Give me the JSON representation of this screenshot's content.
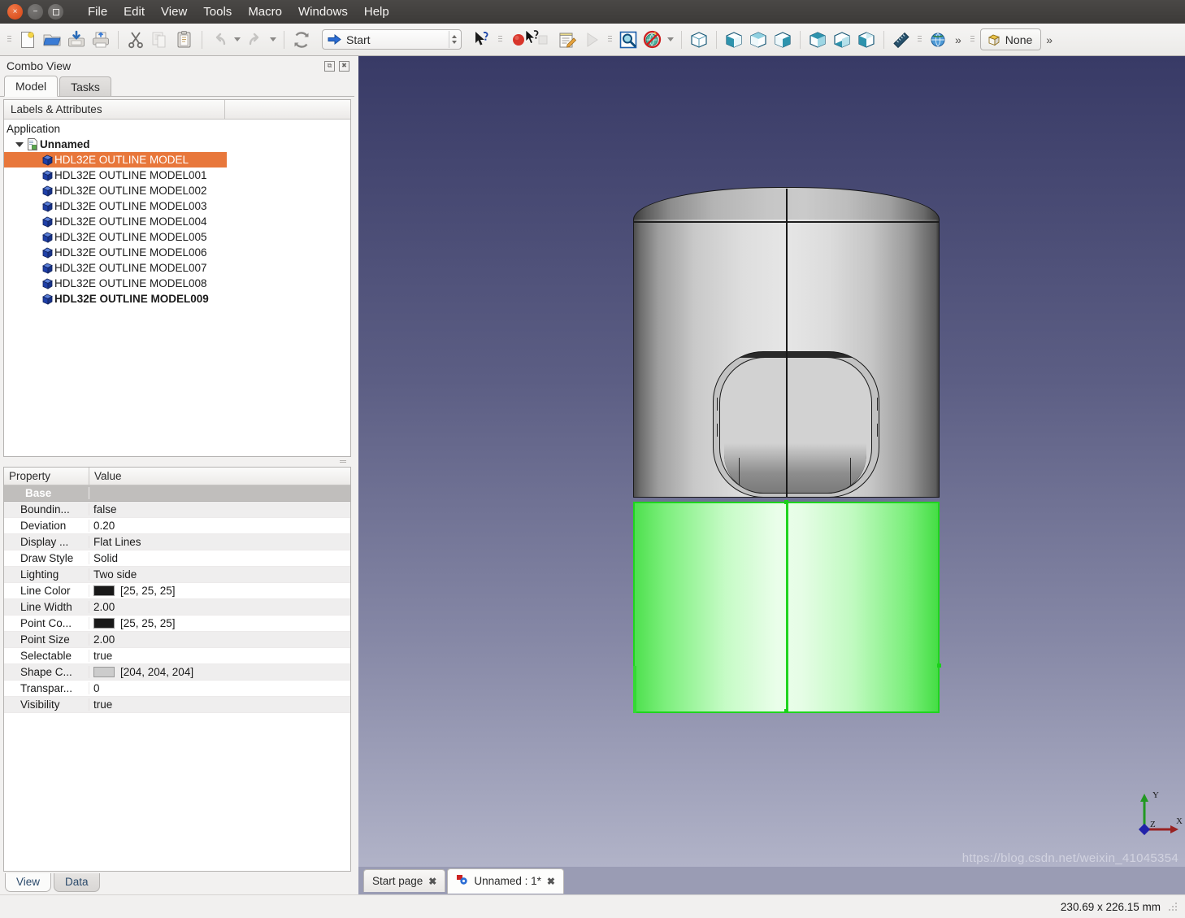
{
  "window": {
    "buttons": [
      {
        "name": "close",
        "glyph": "×"
      },
      {
        "name": "minimize",
        "glyph": "−"
      },
      {
        "name": "maximize",
        "glyph": ""
      }
    ]
  },
  "menubar": {
    "items": [
      "File",
      "Edit",
      "View",
      "Tools",
      "Macro",
      "Windows",
      "Help"
    ]
  },
  "toolbar": {
    "file_group": [
      {
        "name": "new-document-icon",
        "tip": "New"
      },
      {
        "name": "open-folder-icon",
        "tip": "Open"
      },
      {
        "name": "save-document-icon",
        "tip": "Save"
      },
      {
        "name": "print-icon",
        "tip": "Print"
      }
    ],
    "clipboard_group": [
      {
        "name": "cut-scissors-icon",
        "tip": "Cut"
      },
      {
        "name": "copy-icon",
        "tip": "Copy"
      },
      {
        "name": "paste-icon",
        "tip": "Paste"
      }
    ],
    "history_group": [
      {
        "name": "undo-icon",
        "tip": "Undo"
      },
      {
        "name": "redo-icon",
        "tip": "Redo"
      }
    ],
    "refresh": {
      "name": "refresh-icon",
      "tip": "Refresh"
    },
    "workbench": {
      "label": "Start",
      "icon": "blue-right-arrow-icon",
      "tip": "Switch between workbenches"
    },
    "whats_this": {
      "name": "whats-this-cursor-icon",
      "tip": "What's This?"
    },
    "macro_group": [
      {
        "name": "macro-record-icon",
        "tip": "Macro recording"
      },
      {
        "name": "macro-stop-icon",
        "tip": "Stop macro recording"
      },
      {
        "name": "macro-edit-icon",
        "tip": "Macros"
      },
      {
        "name": "macro-execute-icon",
        "tip": "Execute macro"
      }
    ],
    "view_group": [
      {
        "name": "fit-all-icon",
        "tip": "Fit all"
      },
      {
        "name": "draw-style-no-icon",
        "tip": "Draw style"
      }
    ],
    "std_views": [
      {
        "name": "axonometric-view-icon",
        "tip": "Axonometric"
      },
      {
        "name": "front-view-icon",
        "tip": "Front"
      },
      {
        "name": "top-view-icon",
        "tip": "Top"
      },
      {
        "name": "right-view-icon",
        "tip": "Right"
      },
      {
        "name": "rear-view-icon",
        "tip": "Rear"
      },
      {
        "name": "bottom-view-icon",
        "tip": "Bottom"
      },
      {
        "name": "left-view-icon",
        "tip": "Left"
      }
    ],
    "measure": {
      "name": "measure-ruler-icon",
      "tip": "Measure"
    },
    "globe": {
      "name": "globe-icon",
      "tip": "Web"
    },
    "overflow_glyph": "»",
    "appearance": {
      "label": "None",
      "icon": "part-none-icon"
    }
  },
  "combo_view": {
    "title": "Combo View",
    "float_glyph": "⧉",
    "close_glyph": "✖",
    "tabs": [
      {
        "label": "Model",
        "active": true
      },
      {
        "label": "Tasks",
        "active": false
      }
    ],
    "tree": {
      "columns": [
        "Labels & Attributes",
        ""
      ],
      "root": "Application",
      "document": "Unnamed",
      "items": [
        {
          "label": "HDL32E OUTLINE MODEL",
          "selected": true,
          "bold": false
        },
        {
          "label": "HDL32E OUTLINE MODEL001",
          "selected": false,
          "bold": false
        },
        {
          "label": "HDL32E OUTLINE MODEL002",
          "selected": false,
          "bold": false
        },
        {
          "label": "HDL32E OUTLINE MODEL003",
          "selected": false,
          "bold": false
        },
        {
          "label": "HDL32E OUTLINE MODEL004",
          "selected": false,
          "bold": false
        },
        {
          "label": "HDL32E OUTLINE MODEL005",
          "selected": false,
          "bold": false
        },
        {
          "label": "HDL32E OUTLINE MODEL006",
          "selected": false,
          "bold": false
        },
        {
          "label": "HDL32E OUTLINE MODEL007",
          "selected": false,
          "bold": false
        },
        {
          "label": "HDL32E OUTLINE MODEL008",
          "selected": false,
          "bold": false
        },
        {
          "label": "HDL32E OUTLINE MODEL009",
          "selected": false,
          "bold": true
        }
      ]
    },
    "property_editor": {
      "columns": [
        "Property",
        "Value"
      ],
      "group_label": "Base",
      "rows": [
        {
          "key": "Boundin...",
          "value": "false",
          "swatch": null
        },
        {
          "key": "Deviation",
          "value": "0.20",
          "swatch": null
        },
        {
          "key": "Display ...",
          "value": "Flat Lines",
          "swatch": null
        },
        {
          "key": "Draw Style",
          "value": "Solid",
          "swatch": null
        },
        {
          "key": "Lighting",
          "value": "Two side",
          "swatch": null
        },
        {
          "key": "Line Color",
          "value": "[25, 25, 25]",
          "swatch": "#191919"
        },
        {
          "key": "Line Width",
          "value": "2.00",
          "swatch": null
        },
        {
          "key": "Point Co...",
          "value": "[25, 25, 25]",
          "swatch": "#191919"
        },
        {
          "key": "Point Size",
          "value": "2.00",
          "swatch": null
        },
        {
          "key": "Selectable",
          "value": "true",
          "swatch": null
        },
        {
          "key": "Shape C...",
          "value": "[204, 204, 204]",
          "swatch": "#cccccc"
        },
        {
          "key": "Transpar...",
          "value": "0",
          "swatch": null
        },
        {
          "key": "Visibility",
          "value": "true",
          "swatch": null
        }
      ]
    },
    "bottom_tabs": [
      {
        "label": "View",
        "active": true
      },
      {
        "label": "Data",
        "active": false
      }
    ]
  },
  "view3d": {
    "axis": {
      "x_label": "X",
      "y_label": "Y",
      "z_label": "Z",
      "x_color": "#992222",
      "y_color": "#229922",
      "z_color": "#2222aa"
    },
    "selection_color": "#1fd41f",
    "shape_color": "#cccccc",
    "background_top": "#383a66",
    "background_bottom": "#b1b3c8",
    "watermark": "https://blog.csdn.net/weixin_41045354"
  },
  "mdi_tabs": [
    {
      "label": "Start page",
      "active": false,
      "close_glyph": "✖",
      "icon": null
    },
    {
      "label": "Unnamed : 1*",
      "active": true,
      "close_glyph": "✖",
      "icon": "freecad-doc-icon"
    }
  ],
  "statusbar": {
    "dimension": "230.69 x 226.15 mm"
  }
}
